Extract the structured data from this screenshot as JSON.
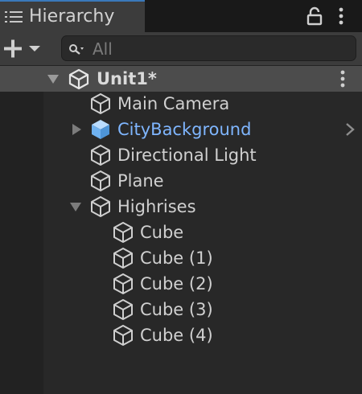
{
  "panel": {
    "tab_title": "Hierarchy",
    "tab_icon": "list-icon",
    "lock_icon": "lock-icon",
    "menu_icon": "kebab-menu-icon",
    "accent_color": "#3a79bb"
  },
  "toolbar": {
    "add_icon": "plus-icon",
    "dropdown_icon": "dropdown-arrow-icon",
    "search_icon": "search-icon",
    "search_placeholder": "All"
  },
  "scene": {
    "name": "Unit1*",
    "icon": "unity-logo-icon",
    "expanded": true,
    "menu_icon": "kebab-menu-icon"
  },
  "items": [
    {
      "label": "Main Camera",
      "icon": "gameobject-cube-icon",
      "depth": 1
    },
    {
      "label": "CityBackground",
      "icon": "prefab-cube-icon",
      "depth": 1,
      "prefab": true,
      "collapsed": true,
      "prefab_color": "#7fb6ff"
    },
    {
      "label": "Directional Light",
      "icon": "gameobject-cube-icon",
      "depth": 1
    },
    {
      "label": "Plane",
      "icon": "gameobject-cube-icon",
      "depth": 1
    },
    {
      "label": "Highrises",
      "icon": "gameobject-cube-icon",
      "depth": 1,
      "expanded": true
    },
    {
      "label": "Cube",
      "icon": "gameobject-cube-icon",
      "depth": 2
    },
    {
      "label": "Cube (1)",
      "icon": "gameobject-cube-icon",
      "depth": 2
    },
    {
      "label": "Cube (2)",
      "icon": "gameobject-cube-icon",
      "depth": 2
    },
    {
      "label": "Cube (3)",
      "icon": "gameobject-cube-icon",
      "depth": 2
    },
    {
      "label": "Cube (4)",
      "icon": "gameobject-cube-icon",
      "depth": 2
    }
  ]
}
